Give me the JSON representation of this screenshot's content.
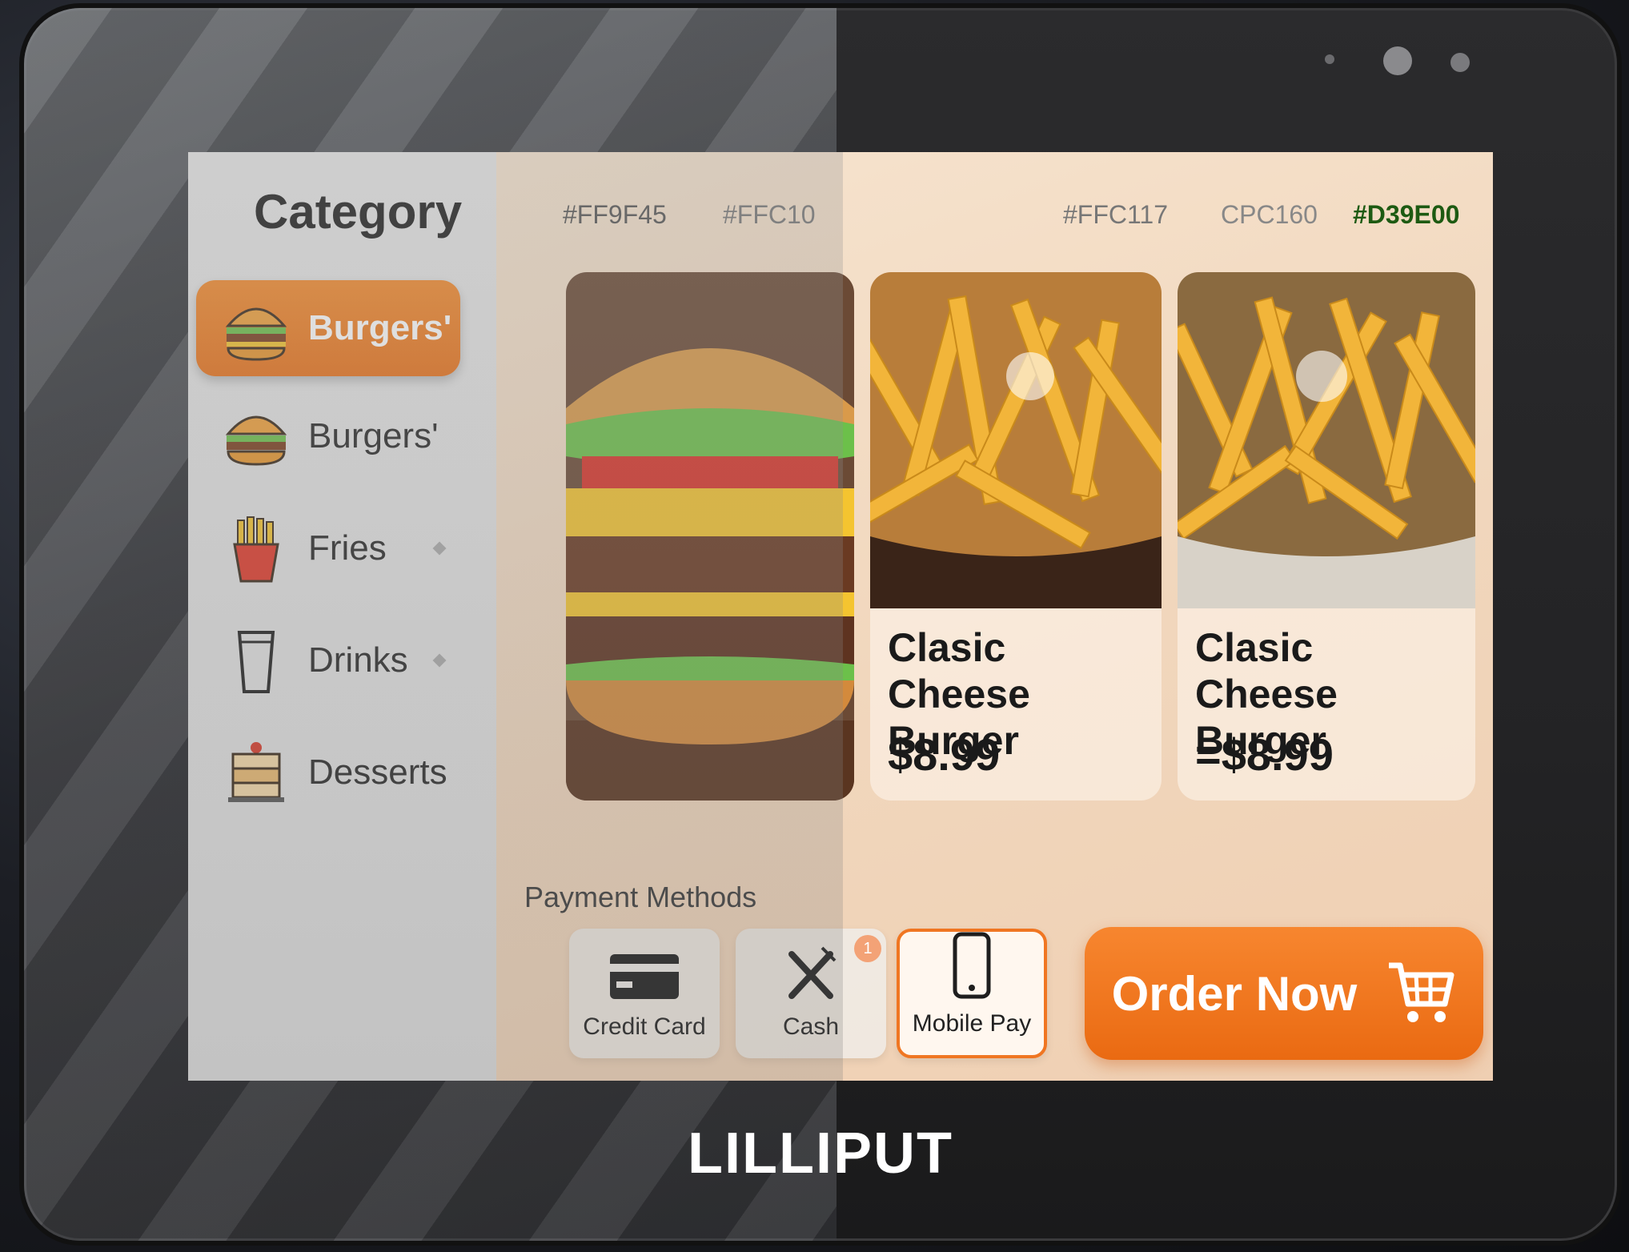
{
  "sidebar": {
    "title": "Category",
    "items": [
      {
        "label": "Burgers'",
        "icon": "burger-icon",
        "active": true
      },
      {
        "label": "Burgers'",
        "icon": "burger-icon",
        "active": false
      },
      {
        "label": "Fries",
        "icon": "fries-icon",
        "active": false
      },
      {
        "label": "Drinks",
        "icon": "cup-icon",
        "active": false
      },
      {
        "label": "Desserts",
        "icon": "cake-icon",
        "active": false
      }
    ]
  },
  "swatches": [
    "#FF9F45",
    "#FFC10",
    "#FFC117",
    "CPC160",
    "#D39E00"
  ],
  "products": [
    {
      "name": "",
      "price": "",
      "image": "burger-photo"
    },
    {
      "name": "Clasic Cheese Burger",
      "price": "$8.99",
      "image": "fries-photo"
    },
    {
      "name": "Clasic Cheese Burger",
      "price": "=$8.99",
      "image": "fries-photo"
    }
  ],
  "payment": {
    "title": "Payment Methods",
    "methods": [
      {
        "label": "Credit Card",
        "icon": "credit-card-icon",
        "selected": false
      },
      {
        "label": "Cash",
        "icon": "utensils-icon",
        "selected": false,
        "badge": "1"
      },
      {
        "label": "Mobile Pay",
        "icon": "smartphone-icon",
        "selected": true
      }
    ]
  },
  "order_button": {
    "label": "Order Now",
    "icon": "cart-icon"
  },
  "brand": "LILLIPUT",
  "colors": {
    "accent": "#F07622",
    "accent_dark": "#D39E00"
  }
}
